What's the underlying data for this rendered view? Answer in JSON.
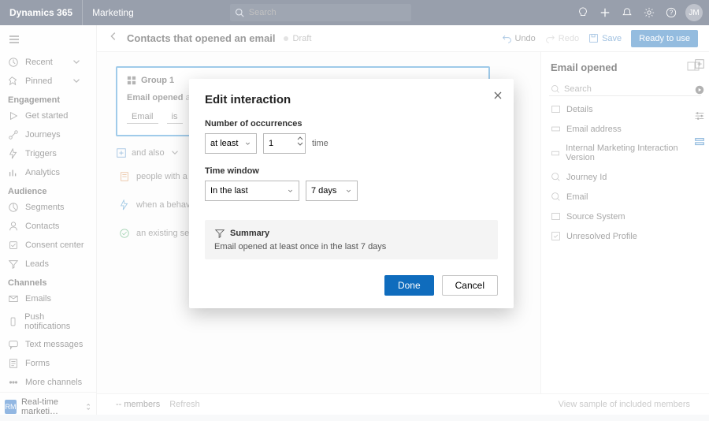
{
  "header": {
    "brand": "Dynamics 365",
    "area": "Marketing",
    "search_placeholder": "Search",
    "avatar_initials": "JM"
  },
  "sidebar": {
    "recent": "Recent",
    "pinned": "Pinned",
    "groups": [
      {
        "title": "Engagement",
        "items": [
          "Get started",
          "Journeys",
          "Triggers",
          "Analytics"
        ]
      },
      {
        "title": "Audience",
        "items": [
          "Segments",
          "Contacts",
          "Consent center",
          "Leads"
        ]
      },
      {
        "title": "Channels",
        "items": [
          "Emails",
          "Push notifications",
          "Text messages",
          "Forms",
          "More channels"
        ]
      }
    ],
    "footer_badge": "RM",
    "footer_text": "Real-time marketi…"
  },
  "cmdbar": {
    "title": "Contacts that opened an email",
    "status": "Draft",
    "undo": "Undo",
    "redo": "Redo",
    "save": "Save",
    "ready": "Ready to use"
  },
  "builder": {
    "group_label": "Group 1",
    "condition_prefix": "Email opened",
    "condition_qualifier": "at l",
    "filter_attr": "Email",
    "filter_op": "is",
    "andalso": "and also",
    "hints": [
      "people with a sp",
      "when a behavio",
      "an existing segm"
    ]
  },
  "rightpanel": {
    "title": "Email opened",
    "search_placeholder": "Search",
    "items": [
      "Details",
      "Email address",
      "Internal Marketing Interaction Version",
      "Journey Id",
      "Email",
      "Source System",
      "Unresolved Profile"
    ]
  },
  "footer": {
    "members_label": "-- members",
    "refresh": "Refresh",
    "sample": "View sample of included members"
  },
  "dialog": {
    "title": "Edit interaction",
    "occurrences_label": "Number of occurrences",
    "occ_operator": "at least",
    "occ_value": "1",
    "occ_unit": "time",
    "window_label": "Time window",
    "window_op": "In the last",
    "window_span": "7 days",
    "summary_label": "Summary",
    "summary_text": "Email opened at least once in the last 7 days",
    "done": "Done",
    "cancel": "Cancel"
  }
}
